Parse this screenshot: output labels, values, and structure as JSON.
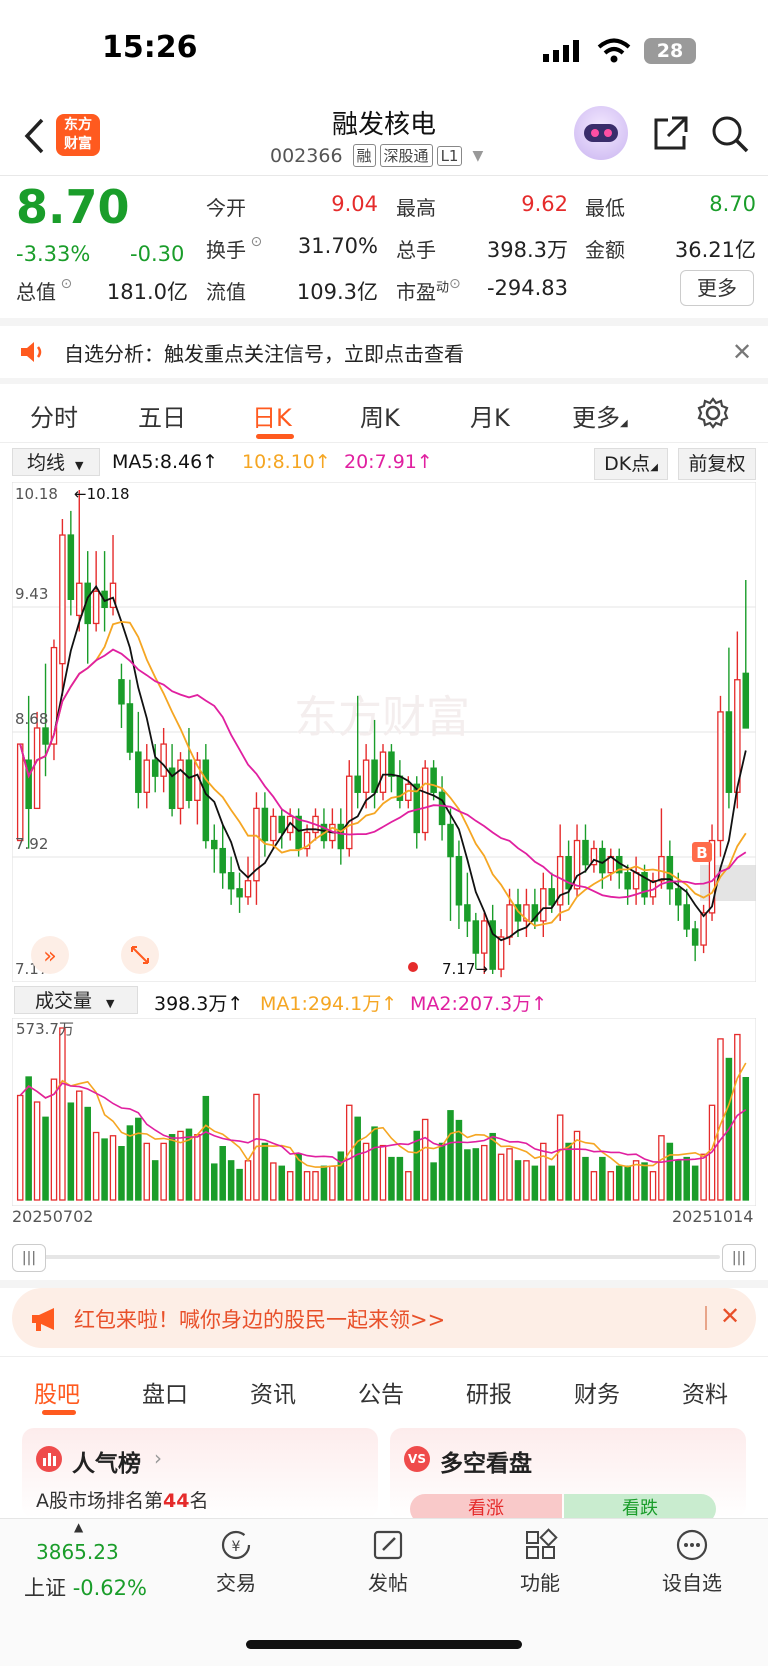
{
  "status_bar": {
    "time": "15:26",
    "battery": "28"
  },
  "header": {
    "logo_text_1": "东方",
    "logo_text_2": "财富",
    "title": "融发核电",
    "code": "002366",
    "tags": [
      "融",
      "深股通",
      "L1"
    ]
  },
  "quote": {
    "price": "8.70",
    "change_pct": "-3.33%",
    "change": "-0.30",
    "open_label": "今开",
    "open": "9.04",
    "high_label": "最高",
    "high": "9.62",
    "low_label": "最低",
    "low": "8.70",
    "turnover_label": "换手",
    "turnover": "31.70%",
    "volume_label": "总手",
    "volume": "398.3万",
    "amount_label": "金额",
    "amount": "36.21亿",
    "mcap_label": "总值",
    "mcap": "181.0亿",
    "float_label": "流值",
    "float": "109.3亿",
    "pe_label": "市盈",
    "pe_sup": "动",
    "pe": "-294.83",
    "more_label": "更多"
  },
  "notice": {
    "text": "自选分析：触发重点关注信号，立即点击查看"
  },
  "chart_tabs": [
    "分时",
    "五日",
    "日K",
    "周K",
    "月K",
    "更多"
  ],
  "active_tab": "日K",
  "ma_bar": {
    "selector": "均线",
    "ma5": "MA5:8.46↑",
    "ma10": "10:8.10↑",
    "ma20": "20:7.91↑",
    "dk": "DK点",
    "adjust": "前复权"
  },
  "price_axis": [
    "10.18",
    "9.43",
    "8.68",
    "7.92",
    "7.17"
  ],
  "annotations": {
    "high_mark": "←10.18",
    "low_mark": "7.17→",
    "buy_badge": "B",
    "watermark": "东方财富"
  },
  "volume_bar": {
    "selector": "成交量",
    "vol": "398.3万↑",
    "ma1": "MA1:294.1万↑",
    "ma2": "MA2:207.3万↑",
    "max_label": "573.7万"
  },
  "dates": {
    "start": "20250702",
    "end": "20251014"
  },
  "colors": {
    "up": "#e52b2b",
    "down": "#1a9d2a",
    "ma5": "#000000",
    "ma10": "#f5a623",
    "ma20": "#e020a0",
    "brand": "#ff5a1f"
  },
  "banner": {
    "text": "红包来啦！喊你身边的股民一起来领>>"
  },
  "bottom_tabs": [
    "股吧",
    "盘口",
    "资讯",
    "公告",
    "研报",
    "财务",
    "资料"
  ],
  "cards": {
    "popular_title": "人气榜",
    "popular_sub_prefix": "A股市场排名第",
    "popular_rank": "44",
    "popular_sub_suffix": "名",
    "vs_title": "多空看盘",
    "vs_bull": "看涨",
    "vs_bear": "看跌"
  },
  "bottom_nav": {
    "index_value": "3865.23",
    "index_label": "上证",
    "index_change": "-0.62%",
    "items": [
      "交易",
      "发帖",
      "功能",
      "设自选"
    ]
  },
  "chart_data": {
    "type": "candlestick",
    "x_range": [
      "20250702",
      "20251014"
    ],
    "ylim": [
      7.17,
      10.18
    ],
    "candles": [
      [
        8.0,
        8.6,
        8.0,
        8.6
      ],
      [
        8.5,
        8.2,
        8.9,
        7.95
      ],
      [
        8.2,
        8.7,
        8.2,
        8.8
      ],
      [
        8.7,
        8.6,
        9.1,
        8.4
      ],
      [
        8.6,
        9.2,
        8.5,
        9.25
      ],
      [
        9.1,
        9.9,
        8.9,
        10.0
      ],
      [
        9.9,
        9.5,
        10.05,
        9.4
      ],
      [
        9.4,
        9.6,
        9.3,
        10.18
      ],
      [
        9.6,
        9.35,
        9.8,
        9.1
      ],
      [
        9.35,
        9.55,
        9.3,
        9.8
      ],
      [
        9.55,
        9.45,
        9.8,
        9.3
      ],
      [
        9.45,
        9.6,
        9.4,
        9.9
      ],
      [
        9.0,
        8.85,
        9.1,
        8.7
      ],
      [
        8.85,
        8.55,
        9.0,
        8.5
      ],
      [
        8.55,
        8.3,
        8.8,
        8.2
      ],
      [
        8.3,
        8.5,
        8.2,
        8.6
      ],
      [
        8.5,
        8.4,
        8.6,
        8.3
      ],
      [
        8.4,
        8.6,
        8.3,
        8.7
      ],
      [
        8.45,
        8.2,
        8.6,
        8.15
      ],
      [
        8.2,
        8.5,
        8.1,
        8.55
      ],
      [
        8.5,
        8.25,
        8.7,
        8.2
      ],
      [
        8.25,
        8.5,
        8.1,
        8.55
      ],
      [
        8.5,
        8.0,
        8.6,
        7.95
      ],
      [
        8.0,
        7.95,
        8.1,
        7.8
      ],
      [
        7.95,
        7.8,
        8.1,
        7.7
      ],
      [
        7.8,
        7.7,
        7.9,
        7.6
      ],
      [
        7.7,
        7.65,
        7.8,
        7.55
      ],
      [
        7.65,
        7.75,
        7.6,
        7.9
      ],
      [
        7.75,
        8.2,
        7.6,
        8.3
      ],
      [
        8.2,
        8.0,
        8.3,
        7.9
      ],
      [
        8.0,
        8.15,
        7.95,
        8.2
      ],
      [
        8.15,
        8.05,
        8.2,
        7.95
      ],
      [
        8.05,
        8.15,
        8.0,
        8.2
      ],
      [
        8.15,
        7.95,
        8.2,
        7.9
      ],
      [
        7.95,
        8.05,
        7.9,
        8.1
      ],
      [
        8.05,
        8.15,
        8.0,
        8.2
      ],
      [
        8.1,
        8.0,
        8.2,
        7.95
      ],
      [
        8.0,
        8.1,
        7.95,
        8.2
      ],
      [
        8.1,
        7.95,
        8.2,
        7.85
      ],
      [
        7.95,
        8.4,
        7.9,
        8.5
      ],
      [
        8.4,
        8.3,
        8.9,
        8.2
      ],
      [
        8.3,
        8.5,
        8.2,
        8.6
      ],
      [
        8.5,
        8.3,
        8.75,
        8.2
      ],
      [
        8.3,
        8.55,
        8.25,
        8.6
      ],
      [
        8.55,
        8.4,
        8.6,
        8.3
      ],
      [
        8.4,
        8.25,
        8.5,
        8.2
      ],
      [
        8.25,
        8.35,
        8.2,
        8.4
      ],
      [
        8.35,
        8.05,
        8.4,
        7.95
      ],
      [
        8.05,
        8.45,
        8.0,
        8.5
      ],
      [
        8.45,
        8.3,
        8.5,
        8.25
      ],
      [
        8.3,
        8.1,
        8.4,
        8.0
      ],
      [
        8.1,
        7.9,
        8.2,
        7.5
      ],
      [
        7.9,
        7.6,
        8.0,
        7.45
      ],
      [
        7.6,
        7.5,
        7.8,
        7.4
      ],
      [
        7.5,
        7.3,
        7.55,
        7.2
      ],
      [
        7.3,
        7.5,
        7.17,
        7.55
      ],
      [
        7.5,
        7.2,
        7.6,
        7.17
      ],
      [
        7.2,
        7.4,
        7.15,
        7.45
      ],
      [
        7.4,
        7.6,
        7.35,
        7.7
      ],
      [
        7.6,
        7.5,
        7.7,
        7.4
      ],
      [
        7.5,
        7.6,
        7.4,
        7.7
      ],
      [
        7.6,
        7.5,
        7.7,
        7.45
      ],
      [
        7.5,
        7.7,
        7.4,
        7.8
      ],
      [
        7.7,
        7.6,
        7.8,
        7.55
      ],
      [
        7.6,
        7.9,
        7.5,
        8.1
      ],
      [
        7.9,
        7.7,
        8.0,
        7.6
      ],
      [
        7.7,
        8.0,
        7.65,
        8.1
      ],
      [
        8.0,
        7.85,
        8.1,
        7.8
      ],
      [
        7.85,
        7.95,
        7.8,
        8.0
      ],
      [
        7.95,
        7.8,
        8.0,
        7.7
      ],
      [
        7.8,
        7.9,
        7.75,
        7.95
      ],
      [
        7.9,
        7.8,
        7.95,
        7.7
      ],
      [
        7.8,
        7.7,
        7.85,
        7.6
      ],
      [
        7.7,
        7.8,
        7.6,
        7.9
      ],
      [
        7.8,
        7.65,
        7.85,
        7.6
      ],
      [
        7.65,
        7.75,
        7.6,
        7.8
      ],
      [
        7.75,
        7.9,
        7.7,
        8.2
      ],
      [
        7.9,
        7.7,
        8.0,
        7.6
      ],
      [
        7.7,
        7.6,
        7.8,
        7.5
      ],
      [
        7.6,
        7.45,
        7.7,
        7.4
      ],
      [
        7.45,
        7.35,
        7.5,
        7.25
      ],
      [
        7.35,
        7.55,
        7.3,
        7.6
      ],
      [
        7.55,
        8.0,
        7.5,
        8.1
      ],
      [
        8.0,
        8.8,
        7.9,
        8.9
      ],
      [
        8.8,
        8.3,
        9.2,
        8.2
      ],
      [
        8.3,
        9.0,
        8.2,
        9.3
      ],
      [
        9.04,
        8.7,
        9.62,
        8.7
      ]
    ]
  }
}
